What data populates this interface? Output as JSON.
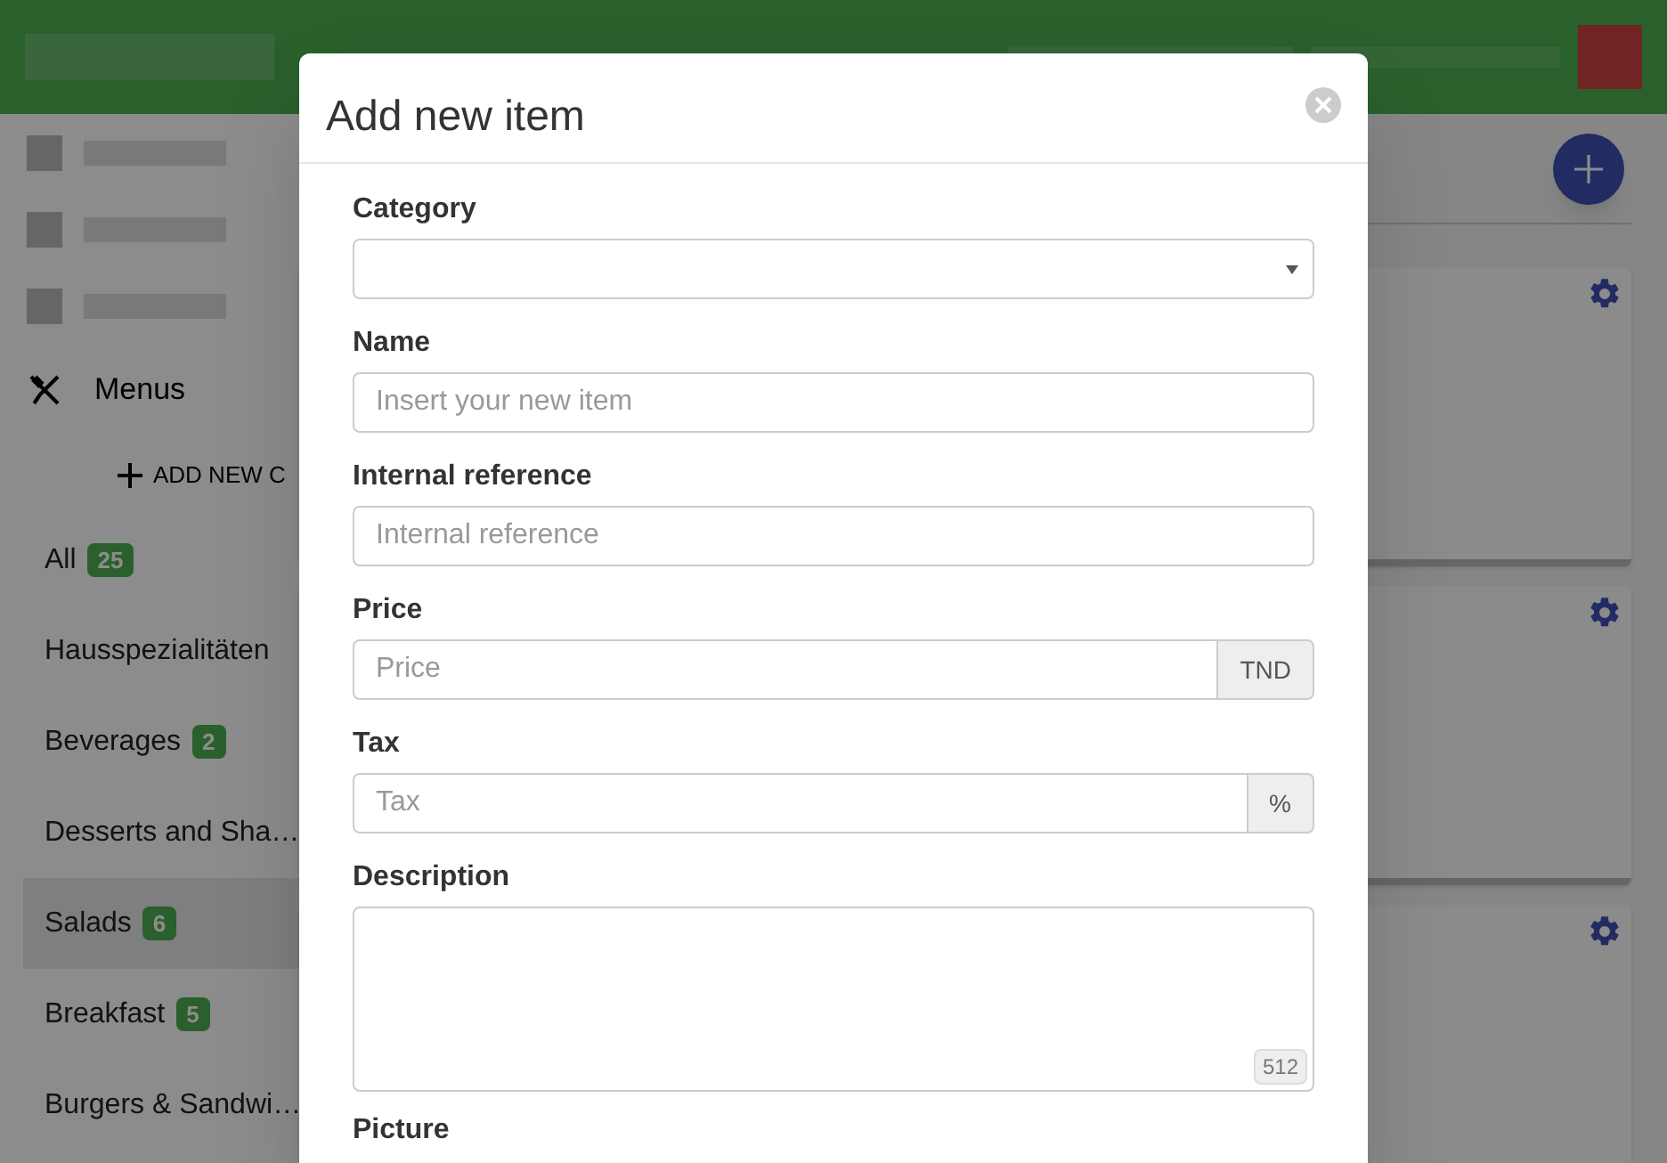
{
  "sidebar": {
    "section": {
      "label": "Menus"
    },
    "add_button": {
      "label": "ADD NEW C"
    },
    "categories": [
      {
        "name": "All",
        "count": "25",
        "selected": false
      },
      {
        "name": "Hausspezialitäten",
        "selected": false
      },
      {
        "name": "Beverages",
        "count": "2",
        "selected": false
      },
      {
        "name": "Desserts and Sha…",
        "selected": false
      },
      {
        "name": "Salads",
        "count": "6",
        "selected": true
      },
      {
        "name": "Breakfast",
        "count": "5",
        "selected": false
      },
      {
        "name": "Burgers & Sandwi…",
        "selected": false
      }
    ]
  },
  "item_cards": [
    {
      "kind": "card"
    },
    {
      "kind": "card"
    },
    {
      "kind": "card"
    }
  ],
  "dialog": {
    "title": "Add new item",
    "fields": [
      {
        "kind": "select",
        "label": "Category"
      },
      {
        "kind": "text",
        "label": "Name",
        "placeholder": "Insert your new item"
      },
      {
        "kind": "text",
        "label": "Internal reference",
        "placeholder": "Internal reference"
      },
      {
        "kind": "addon",
        "label": "Price",
        "placeholder": "Price",
        "addon": "TND"
      },
      {
        "kind": "addon",
        "label": "Tax",
        "placeholder": "Tax",
        "addon": "%"
      },
      {
        "kind": "textarea",
        "label": "Description",
        "counter": "512"
      },
      {
        "kind": "heading",
        "label": "Picture"
      }
    ]
  }
}
